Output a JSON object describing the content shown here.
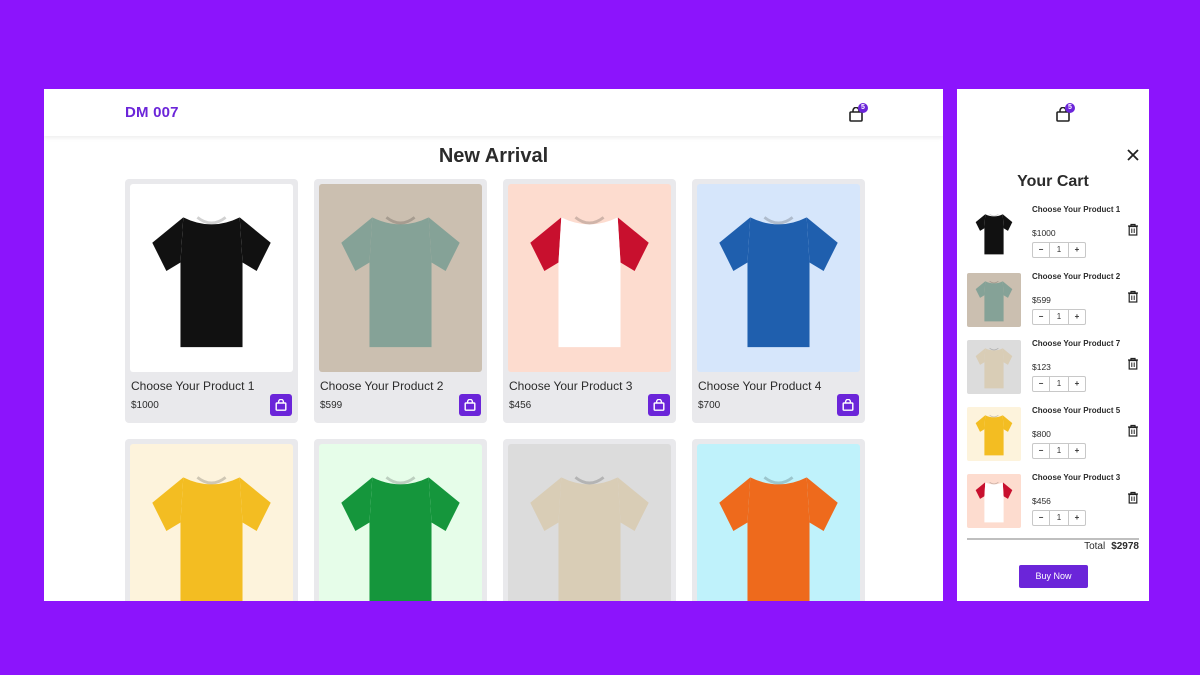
{
  "colors": {
    "background": "#8c14fc",
    "accent": "#6b25d9"
  },
  "header": {
    "logo": "DM 007",
    "cart_count": "5"
  },
  "main": {
    "title": "New Arrival"
  },
  "products": [
    {
      "name": "Choose Your Product 1",
      "price": "$1000",
      "bg": "#ffffff",
      "shirt": "#111111",
      "sleeve": "#111111",
      "icon": "black-tshirt"
    },
    {
      "name": "Choose Your Product 2",
      "price": "$599",
      "bg": "#cbbfb0",
      "shirt": "#85a297",
      "sleeve": "#85a297",
      "icon": "sage-tshirt"
    },
    {
      "name": "Choose Your Product 3",
      "price": "$456",
      "bg": "#fddccf",
      "shirt": "#ffffff",
      "sleeve": "#c8102e",
      "icon": "raglan-tshirt"
    },
    {
      "name": "Choose Your Product 4",
      "price": "$700",
      "bg": "#d6e6fb",
      "shirt": "#1f5fae",
      "sleeve": "#1f5fae",
      "icon": "blue-tshirt"
    },
    {
      "name": "",
      "price": "",
      "bg": "#fdf3dc",
      "shirt": "#f3bd22",
      "sleeve": "#f3bd22",
      "icon": "yellow-tshirt"
    },
    {
      "name": "",
      "price": "",
      "bg": "#e6fde9",
      "shirt": "#15963c",
      "sleeve": "#15963c",
      "icon": "green-tshirt"
    },
    {
      "name": "",
      "price": "",
      "bg": "#dcdcdc",
      "shirt": "#d9cdb6",
      "sleeve": "#d9cdb6",
      "icon": "beige-tshirt"
    },
    {
      "name": "",
      "price": "",
      "bg": "#bff2fb",
      "shirt": "#ee6a1c",
      "sleeve": "#ee6a1c",
      "icon": "orange-tshirt"
    }
  ],
  "cart": {
    "cart_count": "5",
    "title": "Your Cart",
    "items": [
      {
        "name": "Choose Your Product 1",
        "price": "$1000",
        "qty": "1",
        "minus": "−",
        "plus": "+",
        "bg": "#ffffff",
        "shirt": "#111111",
        "sleeve": "#111111"
      },
      {
        "name": "Choose Your Product 2",
        "price": "$599",
        "qty": "1",
        "minus": "−",
        "plus": "+",
        "bg": "#cbbfb0",
        "shirt": "#85a297",
        "sleeve": "#85a297"
      },
      {
        "name": "Choose Your Product 7",
        "price": "$123",
        "qty": "1",
        "minus": "−",
        "plus": "+",
        "bg": "#dcdcdc",
        "shirt": "#d9cdb6",
        "sleeve": "#d9cdb6"
      },
      {
        "name": "Choose Your Product 5",
        "price": "$800",
        "qty": "1",
        "minus": "−",
        "plus": "+",
        "bg": "#fdf3dc",
        "shirt": "#f3bd22",
        "sleeve": "#f3bd22"
      },
      {
        "name": "Choose Your Product 3",
        "price": "$456",
        "qty": "1",
        "minus": "−",
        "plus": "+",
        "bg": "#fddccf",
        "shirt": "#ffffff",
        "sleeve": "#c8102e"
      }
    ],
    "total_label": "Total",
    "total_value": "$2978",
    "buy_label": "Buy Now"
  }
}
